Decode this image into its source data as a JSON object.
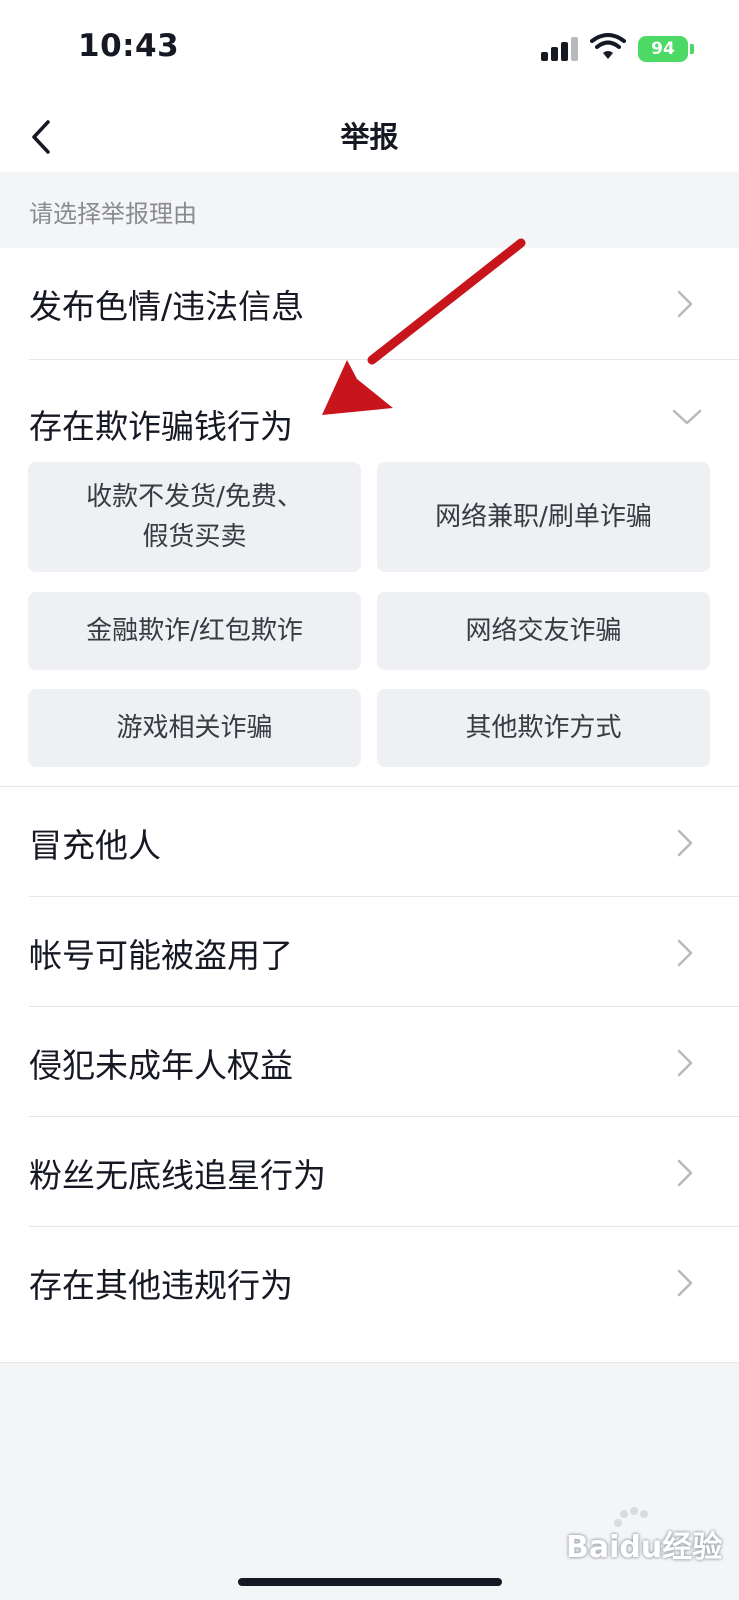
{
  "status_bar": {
    "time": "10:43",
    "battery": "94"
  },
  "nav": {
    "title": "举报",
    "back_icon": "chevron-left-icon"
  },
  "section": {
    "prompt": "请选择举报理由"
  },
  "reasons": [
    {
      "label": "发布色情/违法信息",
      "expanded": false
    },
    {
      "label": "存在欺诈骗钱行为",
      "expanded": true,
      "sub_options": [
        "收款不发货/免费、\n假货买卖",
        "网络兼职/刷单诈骗",
        "金融欺诈/红包欺诈",
        "网络交友诈骗",
        "游戏相关诈骗",
        "其他欺诈方式"
      ]
    },
    {
      "label": "冒充他人",
      "expanded": false
    },
    {
      "label": "帐号可能被盗用了",
      "expanded": false
    },
    {
      "label": "侵犯未成年人权益",
      "expanded": false
    },
    {
      "label": "粉丝无底线追星行为",
      "expanded": false
    },
    {
      "label": "存在其他违规行为",
      "expanded": false
    }
  ],
  "annotation": {
    "arrow_color": "#c8141b"
  },
  "watermark": {
    "text": "Baidu经验"
  },
  "colors": {
    "accent_green": "#4cd964",
    "text": "#161823",
    "muted": "#8a8b91"
  }
}
